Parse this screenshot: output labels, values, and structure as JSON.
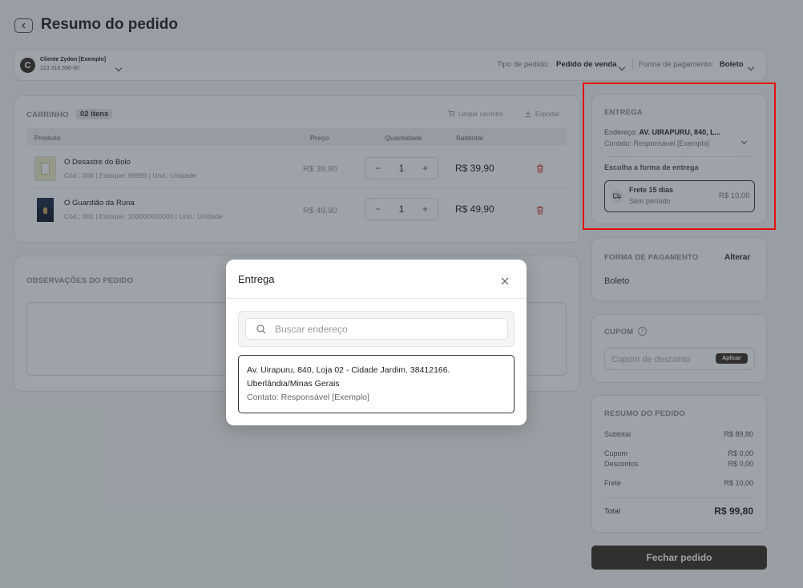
{
  "header": {
    "title": "Resumo do pedido"
  },
  "client": {
    "name": "Cliente Zydon [Exemplo]",
    "doc": "123.316.596-80",
    "avatar_letter": "C"
  },
  "order_type": {
    "label": "Tipo de pedido:",
    "value": "Pedido de venda"
  },
  "payment_form": {
    "label": "Forma de pagamento:",
    "value": "Boleto"
  },
  "cart": {
    "title": "CARRINHO",
    "badge": "02 itens",
    "clear_label": "Limpar carrinho",
    "export_label": "Exportar",
    "columns": {
      "product": "Produto",
      "price": "Preço",
      "qty": "Quantidade",
      "subtotal": "Subtotal"
    },
    "items": [
      {
        "name": "O Desastre do Bolo",
        "meta": "Cód.: 006 | Estoque: 99999 | Und.: Unidade",
        "price": "R$ 39,90",
        "qty": "1",
        "subtotal": "R$ 39,90"
      },
      {
        "name": "O Guardião da Runa",
        "meta": "Cód.: 001 | Estoque: 100000000000 | Und.: Unidade",
        "price": "R$ 49,90",
        "qty": "1",
        "subtotal": "R$ 49,90"
      }
    ]
  },
  "notes": {
    "title": "OBSERVAÇÕES DO PEDIDO"
  },
  "delivery": {
    "title": "ENTREGA",
    "address_label": "Endereço:",
    "address_value": "AV. UIRAPURU, 840, L...",
    "contact": "Contato: Responsável [Exemplo]",
    "choose_label": "Escolha a forma de entrega",
    "option": {
      "name": "Frete 15 dias",
      "period": "Sem período",
      "price": "R$ 10,00"
    }
  },
  "payment": {
    "title": "FORMA DE PAGAMENTO",
    "change": "Alterar",
    "value": "Boleto"
  },
  "coupon": {
    "title": "CUPOM",
    "placeholder": "Cupom de desconto",
    "apply": "Aplicar"
  },
  "summary": {
    "title": "RESUMO DO PEDIDO",
    "subtotal_label": "Subtotal",
    "subtotal": "R$ 89,80",
    "coupon_label": "Cupom",
    "coupon": "R$ 0,00",
    "discount_label": "Descontos",
    "discount": "R$ 0,00",
    "shipping_label": "Frete",
    "shipping": "R$ 10,00",
    "total_label": "Total",
    "total": "R$ 99,80"
  },
  "close_order": "Fechar pedido",
  "modal": {
    "title": "Entrega",
    "search_placeholder": "Buscar endereço",
    "address_line1": "Av. Uirapuru, 840, Loja 02 - Cidade Jardim. 38412166.",
    "address_line2": "Uberlândia/Minas Gerais",
    "contact": "Contato: Responsável [Exemplo]"
  },
  "colors": {
    "brand_dark": "#3c2e24",
    "highlight": "#e0100e",
    "trash": "#d9473f"
  }
}
